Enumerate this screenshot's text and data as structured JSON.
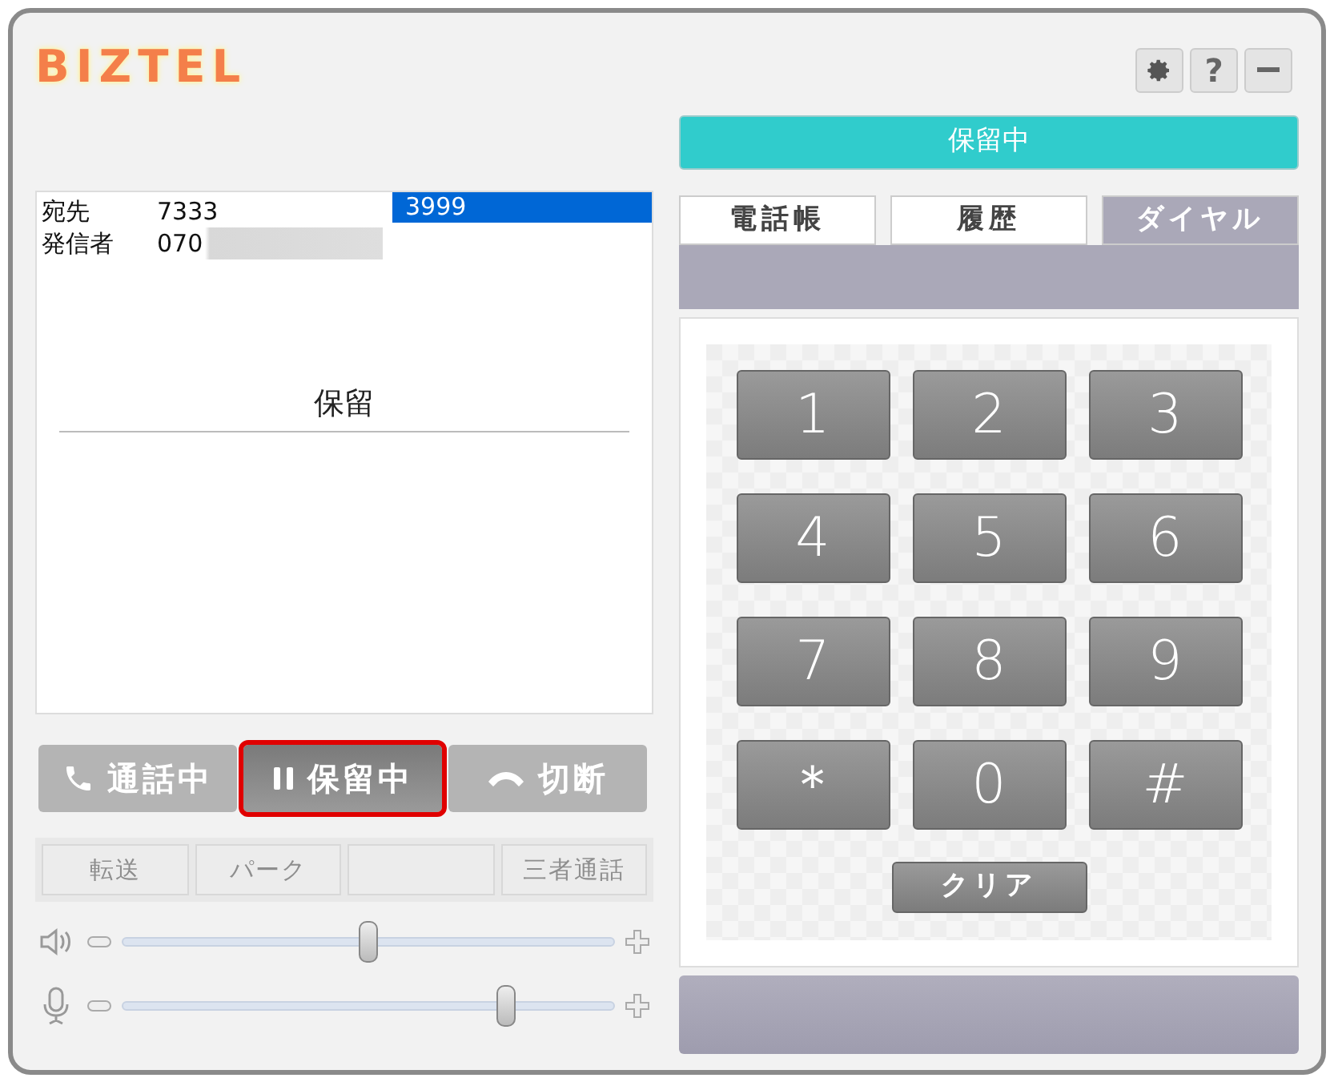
{
  "logo": "BIZTEL",
  "window_controls": [
    {
      "kind": "settings"
    },
    {
      "kind": "help",
      "label": "?"
    },
    {
      "kind": "minimize"
    }
  ],
  "status": "保留中",
  "call_info": {
    "rows": [
      {
        "label": "宛先",
        "value": "7333",
        "redacted": false
      },
      {
        "label": "発信者",
        "value": "070",
        "redacted": true
      }
    ],
    "list": [
      {
        "label": "3999",
        "selected": true
      }
    ],
    "state": "保留"
  },
  "call_buttons": [
    {
      "kind": "phone",
      "label": "通話中",
      "selected": false,
      "highlighted": false
    },
    {
      "kind": "pause",
      "label": "保留中",
      "selected": true,
      "highlighted": true
    },
    {
      "kind": "hangup",
      "label": "切断",
      "selected": false,
      "highlighted": false
    }
  ],
  "feature_buttons": [
    {
      "label": "転送",
      "disabled": true
    },
    {
      "label": "パーク",
      "disabled": true
    },
    {
      "disabled": true
    },
    {
      "label": "三者通話",
      "disabled": true
    }
  ],
  "volume_sliders": [
    {
      "kind": "speaker",
      "level": 0.5
    },
    {
      "kind": "mic",
      "level": 0.78
    }
  ],
  "tabs": [
    {
      "label": "電話帳",
      "selected": false
    },
    {
      "label": "履歴",
      "selected": false
    },
    {
      "label": "ダイヤル",
      "selected": true
    }
  ],
  "keypad": {
    "keys": [
      "1",
      "2",
      "3",
      "4",
      "5",
      "6",
      "7",
      "8",
      "9",
      "＊",
      "0",
      "#"
    ],
    "clear": "クリア"
  }
}
